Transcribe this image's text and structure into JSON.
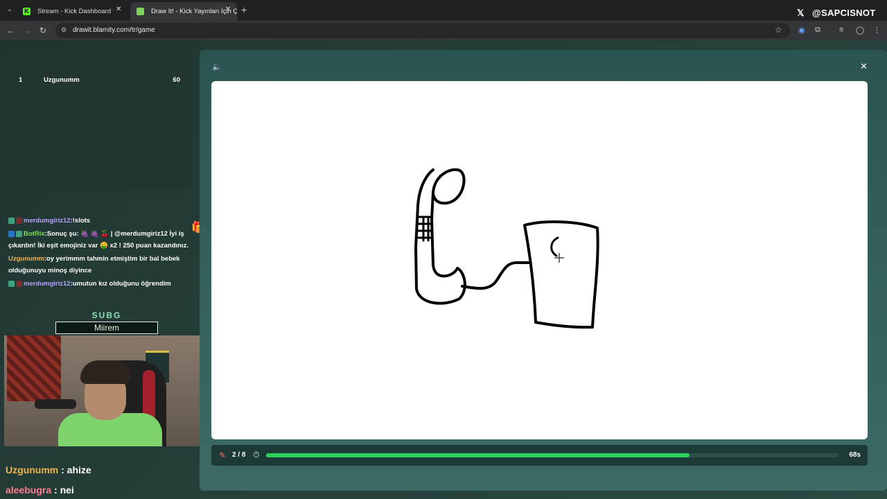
{
  "browser": {
    "tabs": [
      {
        "label": "Stream - Kick Dashboard",
        "favicon": "kick-icon"
      },
      {
        "label": "Draw It! - Kick Yayınları İçin Çizim",
        "favicon": "drawit-icon"
      }
    ],
    "url": "drawit.blamity.com/tr/game",
    "overlay_handle": "@SAPCISNOT"
  },
  "leaderboard": {
    "rows": [
      {
        "rank": "1",
        "name": "Uzgunumm",
        "score": "60"
      }
    ]
  },
  "chat": {
    "messages": [
      {
        "user": "merdumgiriz12",
        "sep": ":",
        "text": "!slots",
        "user_color": "#b7a4ff"
      },
      {
        "user": "BotRix",
        "sep": ":",
        "text": "Sonuç şu: 🍇 🍇 🍒 | @merdumgiriz12 İyi iş çıkardın! İki eşit emojiniz var 🤑 x2 ! 250 puan kazandınız.",
        "user_color": "#7ce24e"
      },
      {
        "user": "Uzgunumm",
        "sep": ":",
        "text": "oy yerimmm tahmin etmiştim bir bal bebek olduğunuyu minoş diyince",
        "user_color": "#f0b449"
      },
      {
        "user": "merdumgiriz12",
        "sep": ":",
        "text": "umutun kız olduğunu öğrendim",
        "user_color": "#b7a4ff"
      }
    ],
    "big_messages": [
      {
        "user": "Uzgunumm",
        "sep": " : ",
        "text": "ahize",
        "user_color": "#f0b449"
      },
      {
        "user": "aleebugra",
        "sep": " : ",
        "text": "nei",
        "user_color": "#ff7c8e"
      }
    ]
  },
  "sub_alert": {
    "title": "SUBG",
    "name": "Miirem"
  },
  "game": {
    "round": "2 / 8",
    "time_left": "68s",
    "progress": 0.74
  },
  "colors": {
    "accent": "#2ed05a",
    "canvas": "#ffffff"
  }
}
